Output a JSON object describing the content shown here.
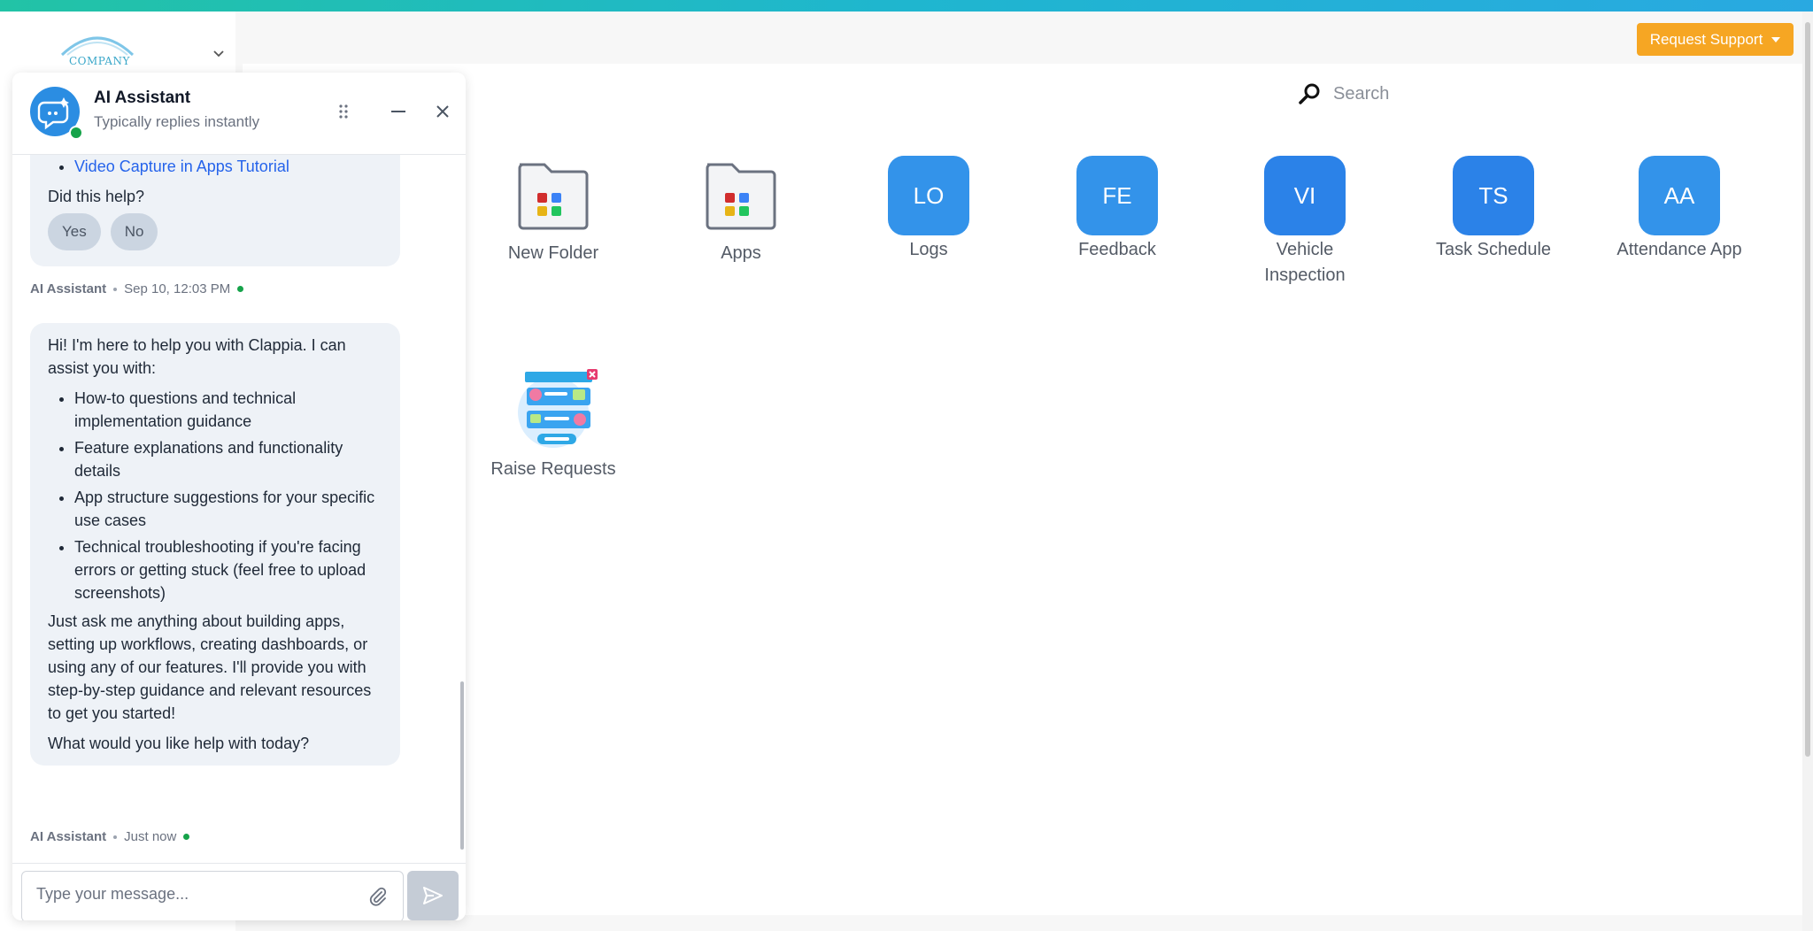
{
  "header": {
    "logo_text": "COMPANY",
    "request_support_label": "Request Support"
  },
  "search": {
    "placeholder": "Search"
  },
  "workspace": {
    "items": [
      {
        "label": "New Folder",
        "kind": "folder"
      },
      {
        "label": "Apps",
        "kind": "folder"
      },
      {
        "label": "Logs",
        "initials": "LO",
        "color": "#3393ea"
      },
      {
        "label": "Feedback",
        "initials": "FE",
        "color": "#3393ea"
      },
      {
        "label": "Vehicle Inspection",
        "label_line1": "Vehicle",
        "label_line2": "Inspection",
        "initials": "VI",
        "color": "#2b82e8"
      },
      {
        "label": "Task Schedule",
        "initials": "TS",
        "color": "#2b82e8"
      },
      {
        "label": "Attendance App",
        "initials": "AA",
        "color": "#3393ea"
      },
      {
        "label": "Raise Requests",
        "kind": "illustration"
      }
    ]
  },
  "chat": {
    "title": "AI Assistant",
    "subtitle": "Typically replies instantly",
    "messages": [
      {
        "link": "Video Capture in Apps Tutorial",
        "question": "Did this help?",
        "yes": "Yes",
        "no": "No",
        "sender": "AI Assistant",
        "time": "Sep 10, 12:03 PM"
      },
      {
        "intro": "Hi! I'm here to help you with Clappia. I can assist you with:",
        "bullets": [
          "How-to questions and technical implementation guidance",
          "Feature explanations and functionality details",
          "App structure suggestions for your specific use cases",
          "Technical troubleshooting if you're facing errors or getting stuck (feel free to upload screenshots)"
        ],
        "body": "Just ask me anything about building apps, setting up workflows, creating dashboards, or using any of our features. I'll provide you with step-by-step guidance and relevant resources to get you started!",
        "closing": "What would you like help with today?",
        "sender": "AI Assistant",
        "time": "Just now"
      }
    ],
    "composer_placeholder": "Type your message..."
  },
  "colors": {
    "accent_orange": "#f6a623",
    "online_green": "#16a34a",
    "bot_blue": "#2b8de2"
  }
}
